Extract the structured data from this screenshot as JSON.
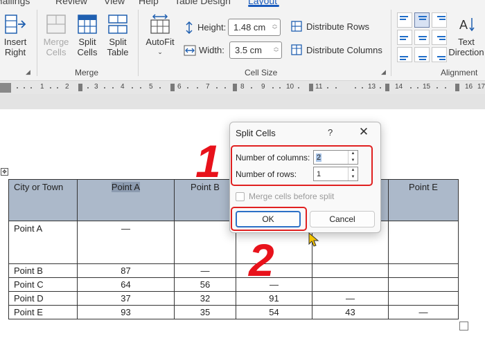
{
  "ribbon": {
    "tabs": [
      {
        "label": "Mailings",
        "active": false
      },
      {
        "label": "Review",
        "active": false
      },
      {
        "label": "View",
        "active": false
      },
      {
        "label": "Help",
        "active": false
      },
      {
        "label": "Table Design",
        "active": false
      },
      {
        "label": "Layout",
        "active": true
      }
    ],
    "insert_right": {
      "line1": "Insert",
      "line2": "Right"
    },
    "merge_group": {
      "label": "Merge",
      "merge_cells": {
        "line1": "Merge",
        "line2": "Cells",
        "enabled": false
      },
      "split_cells": {
        "line1": "Split",
        "line2": "Cells"
      },
      "split_table": {
        "line1": "Split",
        "line2": "Table"
      }
    },
    "cell_size_group": {
      "label": "Cell Size",
      "autofit": "AutoFit",
      "height_label": "Height:",
      "height_value": "1.48 cm",
      "width_label": "Width:",
      "width_value": "3.5 cm",
      "distribute_rows": "Distribute Rows",
      "distribute_columns": "Distribute Columns"
    },
    "alignment_group": {
      "label": "Alignment",
      "text_direction": {
        "line1": "Text",
        "line2": "Direction"
      }
    }
  },
  "ruler": {
    "numbers": [
      "1",
      "1",
      "2",
      "3",
      "4",
      "5",
      "6",
      "7",
      "8",
      "9",
      "10",
      "11",
      "12",
      "13",
      "14",
      "15",
      "16",
      "17"
    ]
  },
  "table": {
    "header": [
      "City or Town",
      "Point A",
      "Point B",
      "",
      "",
      "Point E"
    ],
    "rows": [
      [
        "Point A",
        "—",
        "",
        "",
        "",
        ""
      ],
      [
        "Point B",
        "87",
        "—",
        "",
        "",
        ""
      ],
      [
        "Point C",
        "64",
        "56",
        "—",
        "",
        ""
      ],
      [
        "Point D",
        "37",
        "32",
        "91",
        "—",
        ""
      ],
      [
        "Point E",
        "93",
        "35",
        "54",
        "43",
        "—"
      ]
    ]
  },
  "dialog": {
    "title": "Split Cells",
    "help": "?",
    "close": "✕",
    "columns_label": "Number of columns:",
    "columns_value": "2",
    "rows_label": "Number of rows:",
    "rows_value": "1",
    "merge_before_split": "Merge cells before split",
    "merge_before_split_checked": false,
    "ok": "OK",
    "cancel": "Cancel"
  },
  "annotations": {
    "step1": "1",
    "step2": "2",
    "color": "#e8121b"
  },
  "colors": {
    "header_fill": "#acb9ca",
    "accent": "#185abd"
  }
}
